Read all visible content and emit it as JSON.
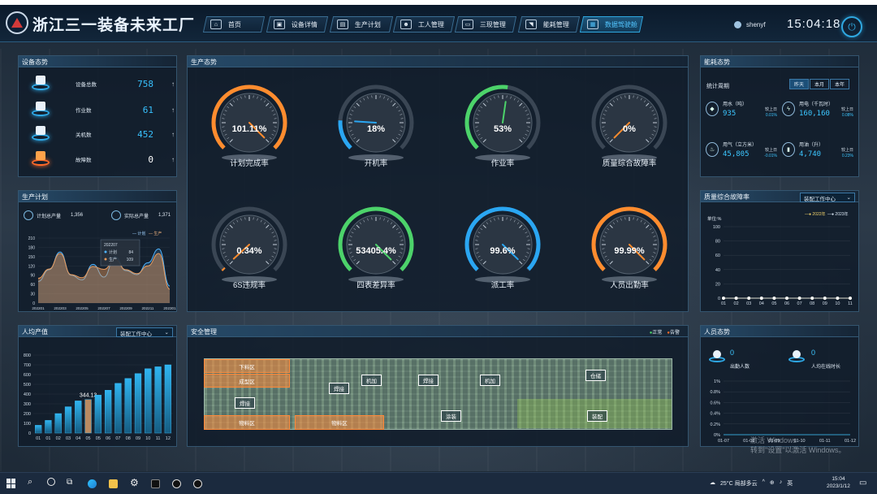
{
  "app": {
    "title": "浙江三一装备未来工厂",
    "user": "shenyf",
    "time": "15:04:18"
  },
  "nav": [
    {
      "label": "首页",
      "icon": "home-icon"
    },
    {
      "label": "设备详情",
      "icon": "device-icon"
    },
    {
      "label": "生产计划",
      "icon": "plan-icon"
    },
    {
      "label": "工人管理",
      "icon": "worker-icon"
    },
    {
      "label": "三现管理",
      "icon": "monitor-icon"
    },
    {
      "label": "能耗管理",
      "icon": "energy-icon"
    },
    {
      "label": "数据驾驶舱",
      "icon": "dashboard-icon"
    }
  ],
  "equipment": {
    "title": "设备态势",
    "items": [
      {
        "label": "设备总数",
        "value": "758"
      },
      {
        "label": "作业数",
        "value": "61"
      },
      {
        "label": "关机数",
        "value": "452"
      },
      {
        "label": "故障数",
        "value": "0"
      }
    ],
    "arrow": "↑"
  },
  "production": {
    "title": "生产态势",
    "gauges": [
      {
        "label": "计划完成率",
        "value": "101.11%",
        "pct": 100,
        "color": "#ff8c2e"
      },
      {
        "label": "开机率",
        "value": "18%",
        "pct": 18,
        "color": "#2aa6f2"
      },
      {
        "label": "作业率",
        "value": "53%",
        "pct": 53,
        "color": "#4cd36a"
      },
      {
        "label": "质量综合故障率",
        "value": "0%",
        "pct": 0,
        "color": "#ff8c2e"
      },
      {
        "label": "6S违规率",
        "value": "0.34%",
        "pct": 1,
        "color": "#ff8c2e"
      },
      {
        "label": "四表差异率",
        "value": "53405.4%",
        "pct": 100,
        "color": "#4cd36a"
      },
      {
        "label": "派工率",
        "value": "99.6%",
        "pct": 99.6,
        "color": "#2aa6f2"
      },
      {
        "label": "人员出勤率",
        "value": "99.99%",
        "pct": 99.99,
        "color": "#ff8c2e"
      }
    ]
  },
  "plan": {
    "title": "生产计划",
    "plan_label": "计划总产量",
    "plan_value": "1,356",
    "actual_label": "实际总产量",
    "actual_value": "1,371",
    "legend": [
      "计划",
      "生产"
    ],
    "tooltip": {
      "date": "202207",
      "plan_label": "计划",
      "plan_value": "84",
      "actual_label": "生产",
      "actual_value": "109"
    }
  },
  "energy": {
    "title": "能耗态势",
    "period_label": "统计周期",
    "tabs": [
      "昨天",
      "本月",
      "本年"
    ],
    "items": [
      {
        "label": "用水（吨）",
        "value": "935",
        "cmp_label": "较上日",
        "cmp": "0.01%",
        "icon": "water-icon"
      },
      {
        "label": "用电（千瓦时）",
        "value": "160,160",
        "cmp_label": "较上日",
        "cmp": "0.08%",
        "icon": "electric-icon"
      },
      {
        "label": "用气（立方米）",
        "value": "45,805",
        "cmp_label": "较上日",
        "cmp": "-0.01%",
        "icon": "gas-icon"
      },
      {
        "label": "用油（升）",
        "value": "4,740",
        "cmp_label": "较上日",
        "cmp": "0.23%",
        "icon": "oil-icon"
      }
    ]
  },
  "quality": {
    "title": "质量综合故障率",
    "select": "装配工作中心",
    "unit": "单位:%"
  },
  "output": {
    "title": "人均产值",
    "select": "装配工作中心",
    "highlight": "344.13"
  },
  "safety": {
    "title": "安全管理",
    "legend": [
      "正常",
      "告警"
    ],
    "zones": [
      "下料区",
      "成型区",
      "焊接",
      "物料区",
      "物料区",
      "机加",
      "焊接",
      "机加",
      "仓储",
      "涂装",
      "装配"
    ]
  },
  "personnel": {
    "title": "人员态势",
    "in_value": "0",
    "in_label": "出勤人数",
    "online_value": "0",
    "online_label": "人均在线时长"
  },
  "taskbar": {
    "weather": "25°C 局部多云",
    "ime": "英",
    "time": "15:04",
    "date": "2023/1/12"
  },
  "watermark": {
    "line1": "激活 Windows",
    "line2": "转到\"设置\"以激活 Windows。"
  },
  "chart_data": [
    {
      "type": "area",
      "title": "生产计划",
      "x": [
        "202201",
        "202202",
        "202203",
        "202204",
        "202205",
        "202206",
        "202207",
        "202208",
        "202209",
        "202210",
        "202211",
        "202212",
        "202301"
      ],
      "xticks": [
        "202201",
        "202203",
        "202205",
        "202207",
        "202209",
        "202211",
        "202301"
      ],
      "ylim": [
        0,
        210
      ],
      "yticks": [
        0,
        30,
        60,
        90,
        120,
        150,
        180,
        210
      ],
      "series": [
        {
          "name": "计划",
          "values": [
            70,
            108,
            165,
            90,
            75,
            125,
            84,
            150,
            105,
            92,
            130,
            175,
            55
          ]
        },
        {
          "name": "生产",
          "values": [
            80,
            110,
            160,
            92,
            82,
            118,
            109,
            140,
            108,
            95,
            120,
            160,
            45
          ]
        }
      ]
    },
    {
      "type": "line",
      "title": "质量综合故障率",
      "x": [
        "01",
        "02",
        "03",
        "04",
        "05",
        "06",
        "07",
        "08",
        "09",
        "10",
        "11"
      ],
      "ylim": [
        0,
        100
      ],
      "yticks": [
        0,
        20,
        40,
        60,
        80,
        100
      ],
      "series": [
        {
          "name": "2022年",
          "values": [
            0,
            0,
            0,
            0,
            0,
            0,
            0,
            0,
            0,
            0,
            0
          ]
        },
        {
          "name": "2023年",
          "values": [
            0,
            0,
            0,
            0,
            0,
            0,
            0,
            0,
            0,
            0,
            0
          ]
        }
      ]
    },
    {
      "type": "bar",
      "title": "人均产值",
      "categories": [
        "01",
        "01",
        "02",
        "03",
        "04",
        "05",
        "05",
        "06",
        "07",
        "08",
        "09",
        "10",
        "11",
        "12"
      ],
      "values": [
        80,
        130,
        200,
        270,
        330,
        344.13,
        390,
        440,
        510,
        560,
        610,
        660,
        680,
        700
      ],
      "ylim": [
        0,
        800
      ],
      "yticks": [
        0,
        100,
        200,
        300,
        400,
        500,
        600,
        700,
        800
      ]
    },
    {
      "type": "line",
      "title": "人员态势",
      "x": [
        "01-07",
        "01-08",
        "01-09",
        "01-10",
        "01-11",
        "01-12"
      ],
      "ylim": [
        0,
        1
      ],
      "yticks": [
        "0%",
        "0.2%",
        "0.4%",
        "0.6%",
        "0.8%",
        "1%"
      ],
      "series": [
        {
          "values": [
            0,
            0,
            0,
            0,
            0,
            0
          ]
        }
      ]
    }
  ]
}
